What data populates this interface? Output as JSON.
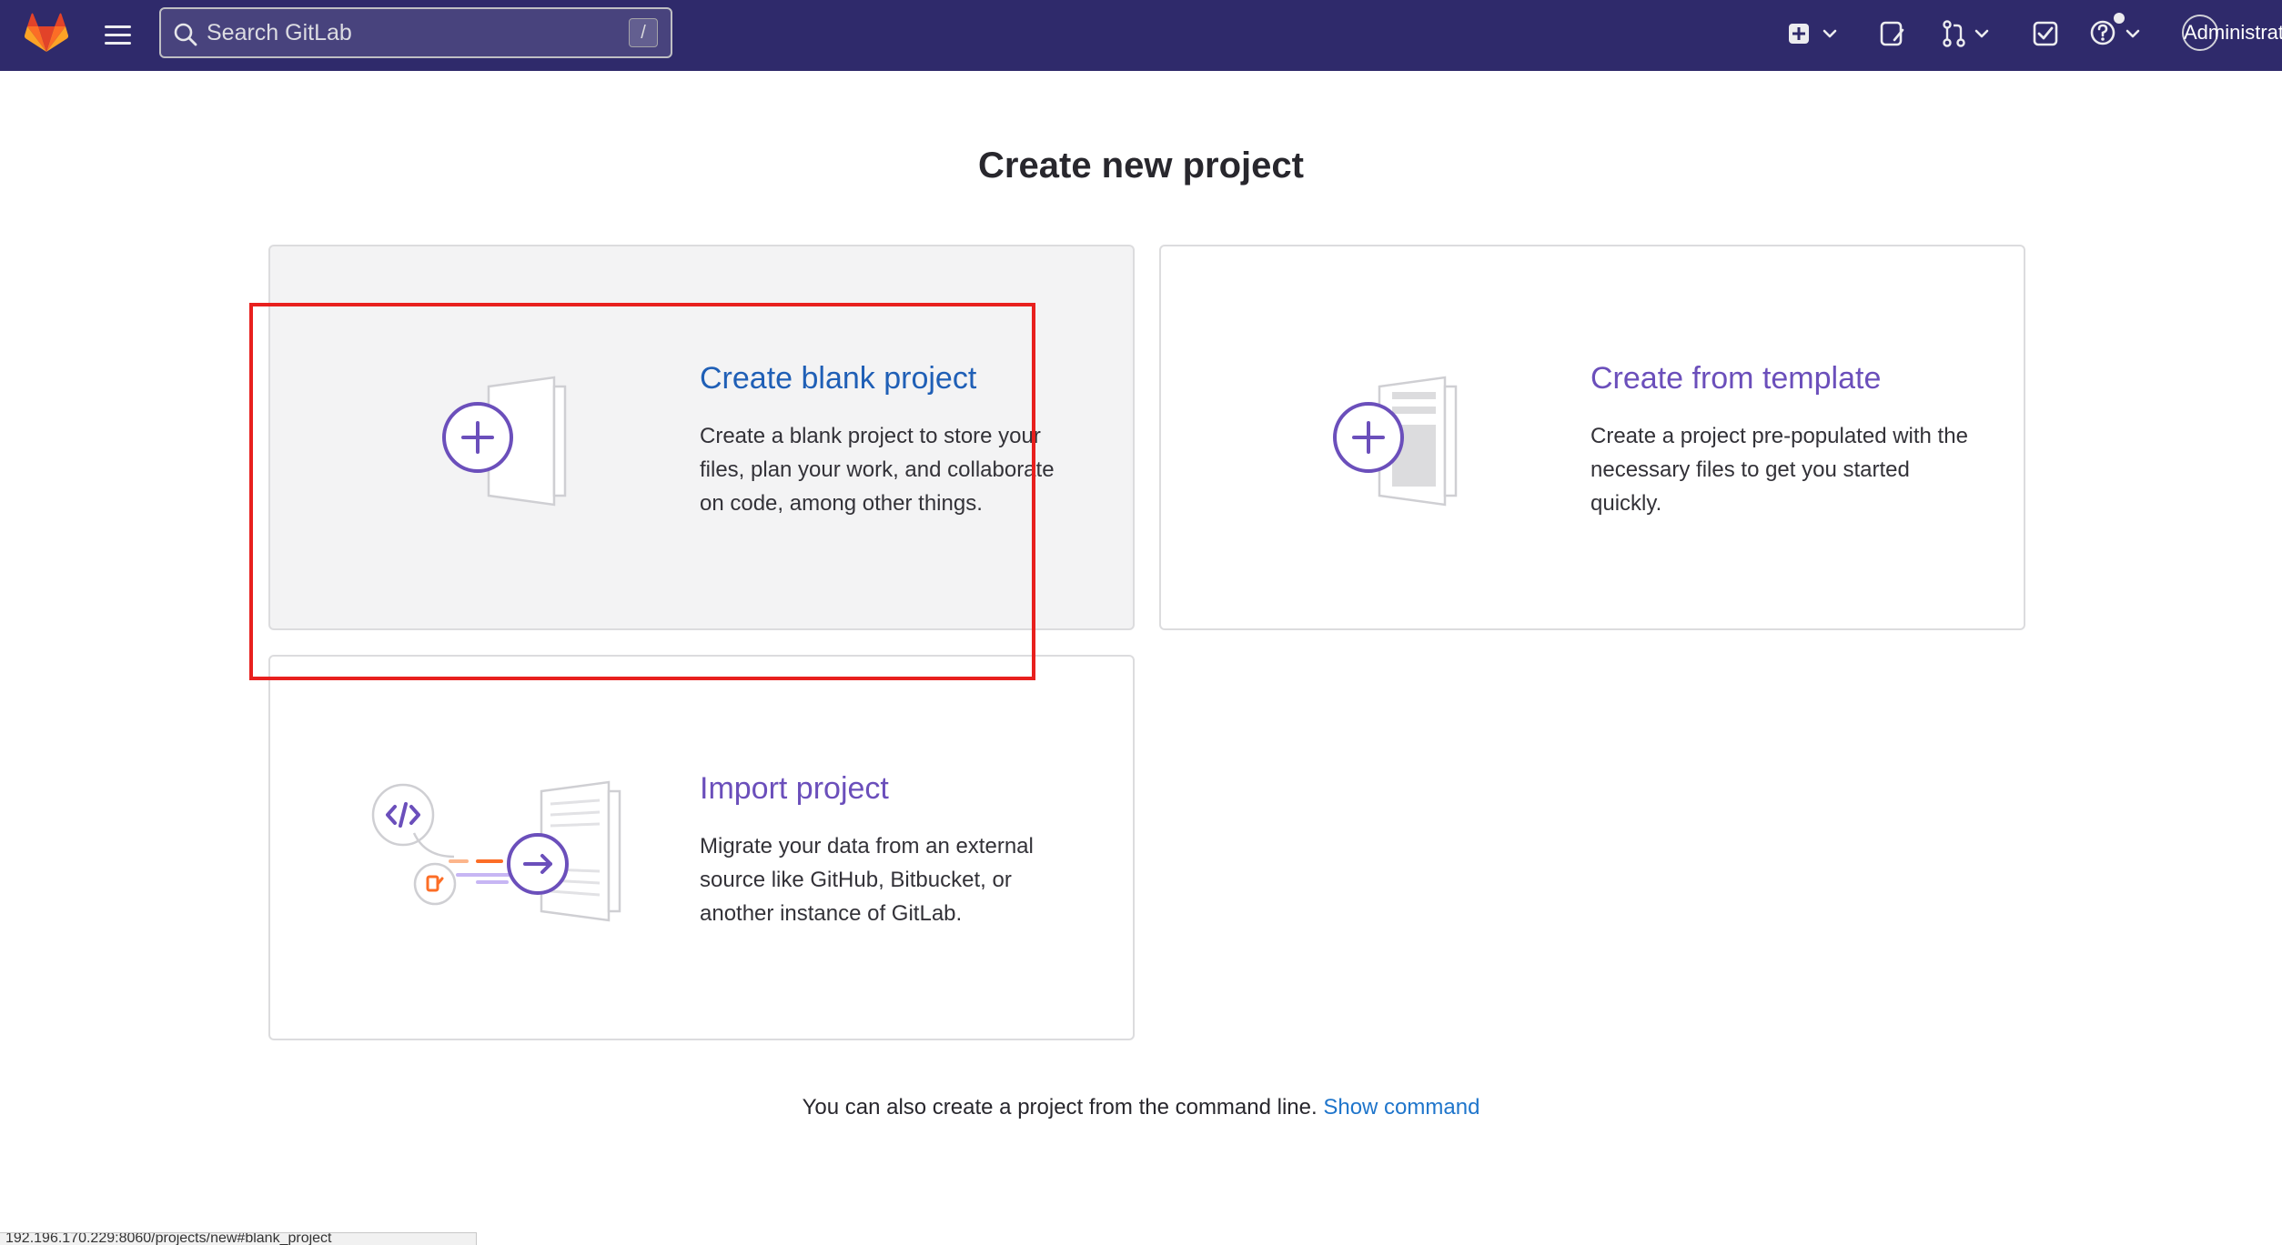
{
  "navbar": {
    "search_placeholder": "Search GitLab",
    "search_shortcut": "/",
    "user_label": "Administrator",
    "icons": [
      "gitlab-logo",
      "hamburger-menu-icon",
      "search-icon",
      "new-item-icon",
      "chevron-down-icon",
      "issues-icon",
      "merge-request-icon",
      "chevron-down-icon",
      "todo-icon",
      "help-icon",
      "chevron-down-icon",
      "avatar"
    ]
  },
  "main": {
    "title": "Create new project",
    "options": [
      {
        "title": "Create blank project",
        "description": "Create a blank project to store your files, plan your work, and collaborate on code, among other things."
      },
      {
        "title": "Create from template",
        "description": "Create a project pre-populated with the necessary files to get you started quickly."
      },
      {
        "title": "Import project",
        "description": "Migrate your data from an external source like GitHub, Bitbucket, or another instance of GitLab."
      }
    ],
    "footer_text": "You can also create a project from the command line.",
    "footer_link": "Show command"
  },
  "status_bar": {
    "url": "192.196.170.229:8060/projects/new#blank_project"
  },
  "colors": {
    "navbar_bg": "#2f2a6b",
    "accent_purple": "#6b4fbb",
    "link_blue": "#1f75cb",
    "highlight_red": "#e8201e"
  }
}
